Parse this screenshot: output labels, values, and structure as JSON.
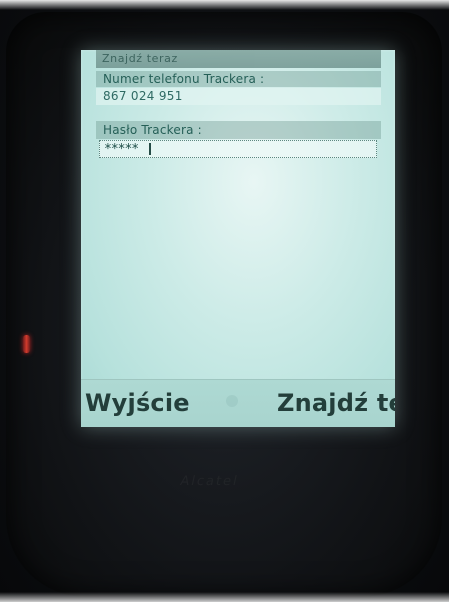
{
  "screen": {
    "title": "Znajdź teraz",
    "fields": [
      {
        "label": "Numer telefonu Trackera :",
        "value": "867 024 951"
      },
      {
        "label": "Hasło Trackera :",
        "value": "*****"
      }
    ],
    "softkeys": {
      "left": "Wyjście",
      "right": "Znajdź te"
    }
  },
  "device": {
    "brand_logo": "Alcatel"
  },
  "colors": {
    "screen_background": "#cbebe6",
    "softkey_bar": "#aed9d3",
    "text": "#233e3a"
  },
  "icons": {
    "status_light": "red-light-icon"
  }
}
